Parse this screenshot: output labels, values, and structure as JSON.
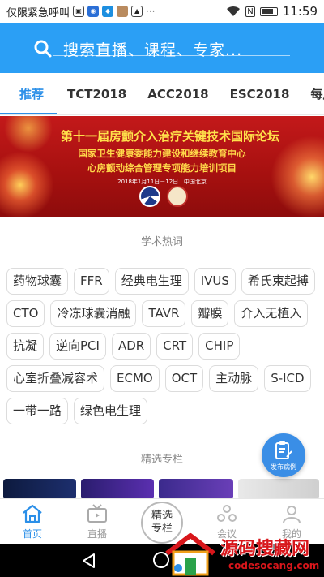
{
  "status_bar": {
    "carrier": "仅限紧急呼叫",
    "time": "11:59"
  },
  "search": {
    "placeholder": "搜索直播、课程、专家..."
  },
  "tabs": [
    {
      "label": "推荐",
      "active": true
    },
    {
      "label": "TCT2018"
    },
    {
      "label": "ACC2018"
    },
    {
      "label": "ESC2018"
    },
    {
      "label": "每周"
    }
  ],
  "banner": {
    "title": "第十一届房颤介入治疗关键技术国际论坛",
    "line1": "国家卫生健康委能力建设和继续教育中心",
    "line2": "心房颤动综合管理专项能力培训项目",
    "date": "2018年1月11日－12日 · 中国北京"
  },
  "sections": {
    "hot_topics_title": "学术热词",
    "featured_title": "精选专栏"
  },
  "hot_tags": [
    [
      "药物球囊",
      "FFR",
      "经典电生理",
      "IVUS",
      "希氏束起搏"
    ],
    [
      "CTO",
      "冷冻球囊消融",
      "TAVR",
      "瓣膜",
      "介入无植入"
    ],
    [
      "抗凝",
      "逆向PCI",
      "ADR",
      "CRT",
      "CHIP"
    ],
    [
      "心室折叠减容术",
      "ECMO",
      "OCT",
      "主动脉",
      "S-ICD"
    ],
    [
      "一带一路",
      "绿色电生理"
    ]
  ],
  "fab": {
    "label": "发布病例",
    "icon": "publish-case-icon"
  },
  "bottom_tabs": {
    "home": "首页",
    "live": "直播",
    "center": "精选专栏",
    "meeting": "会议",
    "mine": "我的"
  },
  "watermark": {
    "text": "源码搜藏网",
    "url": "codesocang.com"
  },
  "colors": {
    "primary": "#2b9ff5",
    "accent": "#2b8fe8",
    "banner_red": "#c3191a",
    "watermark_red": "#d8161b"
  }
}
